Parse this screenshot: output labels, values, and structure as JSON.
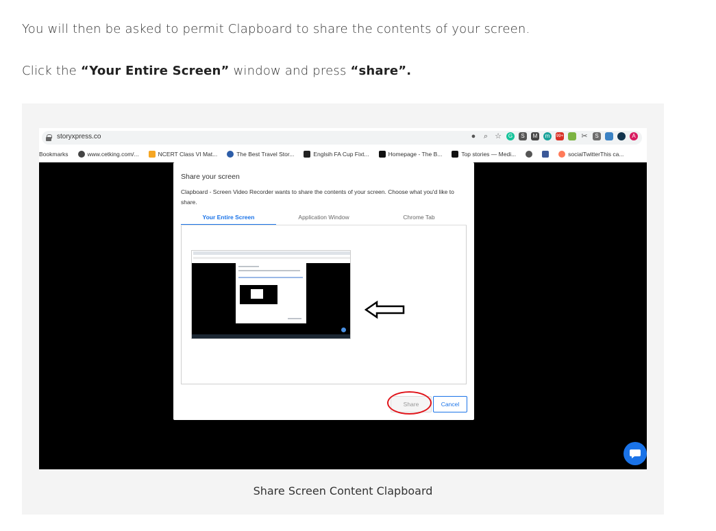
{
  "article": {
    "para1": "You will then be asked to permit Clapboard to share the contents of your screen.",
    "para2": {
      "t1": "Click the ",
      "b1": "“Your Entire Screen”",
      "t2": " window and press ",
      "b2": "“share”."
    },
    "caption": "Share Screen Content Clapboard"
  },
  "browser": {
    "url": "storyxpress.co",
    "extensions": [
      {
        "icon": "lock-badge-icon",
        "label": ""
      },
      {
        "icon": "zoom-icon",
        "label": ""
      },
      {
        "icon": "star-icon",
        "label": "☆"
      },
      {
        "icon": "grammarly-icon",
        "label": "G"
      },
      {
        "icon": "extension-s-icon",
        "label": "S"
      },
      {
        "icon": "extension-m-icon",
        "label": "M"
      },
      {
        "icon": "extension-m-round-icon",
        "label": "m"
      },
      {
        "icon": "extension-99-icon",
        "label": "99+"
      },
      {
        "icon": "mail-icon",
        "label": ""
      },
      {
        "icon": "scissors-icon",
        "label": "✂"
      },
      {
        "icon": "extension-s2-icon",
        "label": "S"
      },
      {
        "icon": "clapper-icon",
        "label": ""
      },
      {
        "icon": "chat-ext-icon",
        "label": ""
      },
      {
        "icon": "profile-avatar-icon",
        "label": "A"
      }
    ],
    "bookmarks": [
      {
        "label": "Bookmarks",
        "icon": "none"
      },
      {
        "label": "www.cetking.com/...",
        "icon": "globe-icon"
      },
      {
        "label": "NCERT Class VI Mat...",
        "icon": "a-icon"
      },
      {
        "label": "The Best Travel Stor...",
        "icon": "globe-icon"
      },
      {
        "label": "Englsih FA Cup Fixt...",
        "icon": "square-icon"
      },
      {
        "label": "Homepage - The B...",
        "icon": "b-icon"
      },
      {
        "label": "Top stories — Medi...",
        "icon": "m-icon"
      },
      {
        "label": "",
        "icon": "globe-icon"
      },
      {
        "label": "",
        "icon": "facebook-icon"
      },
      {
        "label": "socialTwitterThis ca...",
        "icon": "hubspot-icon"
      }
    ]
  },
  "dialog": {
    "title": "Share your screen",
    "description": "Clapboard - Screen Video Recorder wants to share the contents of your screen. Choose what you'd like to share.",
    "tabs": [
      "Your Entire Screen",
      "Application Window",
      "Chrome Tab"
    ],
    "share_label": "Share",
    "cancel_label": "Cancel"
  },
  "colors": {
    "accent": "#1a73e8",
    "highlight_ring": "#e0141a"
  }
}
